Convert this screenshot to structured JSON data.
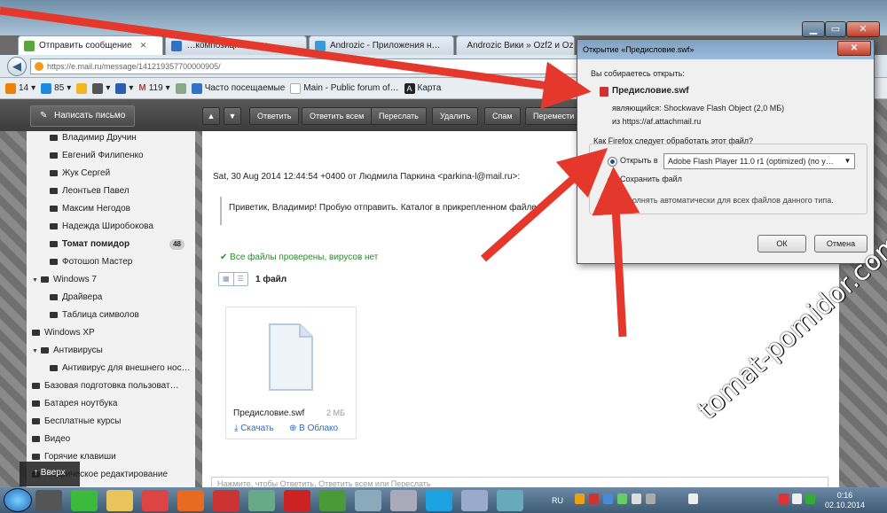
{
  "window": {
    "controls": {
      "minimize": "▁",
      "maximize": "▭",
      "close": "✕"
    }
  },
  "tabs": [
    {
      "label": "Отправить сообщение",
      "icon": "mail-icon",
      "color": "#56a83d"
    },
    {
      "label": "…композиции…",
      "icon": "page-icon",
      "color": "#2f72c7"
    },
    {
      "label": "Androzic - Приложения н…",
      "icon": "play-icon",
      "color": "#3b99d8"
    },
    {
      "label": "Androzic Вики » Ozf2 и Oz…",
      "icon": "page-icon",
      "color": "#d8a432"
    }
  ],
  "address": {
    "url": "https://e.mail.ru/message/14121935770000090​5/"
  },
  "bookmarks": [
    {
      "label": "14",
      "icon": "ok-icon",
      "color": "#ee8208"
    },
    {
      "label": "85",
      "icon": "mail-icon",
      "color": "#168de2"
    },
    {
      "label": "",
      "icon": "pencil-icon",
      "color": "#f3b61f"
    },
    {
      "label": "",
      "icon": "camera-icon",
      "color": "#555"
    },
    {
      "label": "",
      "icon": "b-icon",
      "color": "#2b5fb0"
    },
    {
      "label": "119",
      "icon": "gmail-icon",
      "color": "#d93025"
    },
    {
      "label": "",
      "icon": "tools-icon",
      "color": "#8a8"
    },
    {
      "label": "Часто посещаемые",
      "icon": "star-icon",
      "color": "#2f72c7"
    },
    {
      "label": "Main - Public forum of…",
      "icon": "page-icon",
      "color": "#aaa"
    },
    {
      "label": "Карта",
      "icon": "a-icon",
      "color": "#222"
    }
  ],
  "toolbar": {
    "compose": "Написать письмо",
    "buttons": [
      "Ответить",
      "Ответить всем",
      "Переслать",
      "Удалить",
      "Спам",
      "Перемести"
    ]
  },
  "folders": [
    {
      "label": "Владимир Дручин",
      "level": 2
    },
    {
      "label": "Евгений Филипенко",
      "level": 2
    },
    {
      "label": "Жук Сергей",
      "level": 2
    },
    {
      "label": "Леонтьев Павел",
      "level": 2
    },
    {
      "label": "Максим Негодов",
      "level": 2
    },
    {
      "label": "Надежда Широбокова",
      "level": 2
    },
    {
      "label": "Томат помидор",
      "level": 2,
      "bold": true,
      "badge": "48"
    },
    {
      "label": "Фотошоп Мастер",
      "level": 2
    },
    {
      "label": "Windows 7",
      "level": 1,
      "expand": "▼"
    },
    {
      "label": "Драйвера",
      "level": 2
    },
    {
      "label": "Таблица символов",
      "level": 2
    },
    {
      "label": "Windows XP",
      "level": 1
    },
    {
      "label": "Антивирусы",
      "level": 1,
      "expand": "▼"
    },
    {
      "label": "Антивирус для внешнего нос…",
      "level": 2
    },
    {
      "label": "Базовая подготовка пользоват…",
      "level": 1
    },
    {
      "label": "Батарея ноутбука",
      "level": 1
    },
    {
      "label": "Бесплатные курсы",
      "level": 1
    },
    {
      "label": "Видео",
      "level": 1
    },
    {
      "label": "Горячие клавиши",
      "level": 1
    },
    {
      "label": "…афическое редактирование",
      "level": 1
    }
  ],
  "scroll_top": "↑ Вверх",
  "message": {
    "meta": "Sat, 30 Aug 2014 12:44:54 +0400 от Людмила Паркина <parkina-l@mail.ru>:",
    "body": "Приветик, Владимир! Пробую отправить. Каталог в прикрепленном файле",
    "checked": "✔ Все файлы проверены, вирусов нет",
    "file_count": "1 файл",
    "view_grid": "▦",
    "view_list": "☰",
    "file": {
      "name": "Предисловие.swf",
      "size": "2 МБ",
      "download": "⤓ Скачать",
      "cloud": "⊕ В Облако"
    },
    "reply_placeholder": "Нажмите, чтобы Ответить, Ответить всем или Переслать"
  },
  "dialog": {
    "title": "Открытие «Предисловие.swf»",
    "close": "✕",
    "intro": "Вы собираетесь открыть:",
    "filename": "Предисловие.swf",
    "type": "являющийся:  Shockwave Flash Object (2,0 МБ)",
    "from": "из  https://af.attachmail.ru",
    "question": "Как Firefox следует обработать этот файл?",
    "open_with": "Открыть в",
    "app": "Adobe Flash Player 11.0 r1 (optimized) (по у…",
    "save": "Сохранить файл",
    "auto": "…полнять автоматически для всех файлов данного типа.",
    "ok": "ОК",
    "cancel": "Отмена",
    "open_selected": true
  },
  "watermark": "tomat-pomidor.com",
  "taskbar": {
    "apps": [
      {
        "icon": "start-icon"
      },
      {
        "icon": "grip-icon",
        "color": "#555"
      },
      {
        "icon": "icq-icon",
        "color": "#3cba3c"
      },
      {
        "icon": "folder-icon",
        "color": "#e9c45a"
      },
      {
        "icon": "chrome-icon",
        "color": "#d44"
      },
      {
        "icon": "firefox-icon",
        "color": "#e66a1f"
      },
      {
        "icon": "paint-icon",
        "color": "#c33"
      },
      {
        "icon": "calculator-icon",
        "color": "#6a8"
      },
      {
        "icon": "opera-icon",
        "color": "#c22"
      },
      {
        "icon": "utorrent-icon",
        "color": "#4a9a3a"
      },
      {
        "icon": "brush-icon",
        "color": "#8ab"
      },
      {
        "icon": "tools-icon",
        "color": "#aab"
      },
      {
        "icon": "skype-icon",
        "color": "#1aa3e0"
      },
      {
        "icon": "notepad-icon",
        "color": "#9ac"
      },
      {
        "icon": "network-icon",
        "color": "#6ab"
      }
    ],
    "lang": "RU",
    "time": "0:16",
    "date": "02.10.2014"
  }
}
